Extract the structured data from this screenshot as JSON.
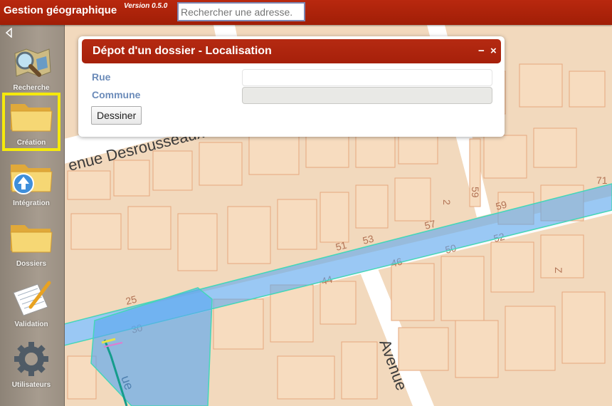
{
  "header": {
    "title": "Gestion géographique",
    "version": "Version 0.5.0",
    "search_placeholder": "Rechercher une adresse."
  },
  "sidebar": {
    "items": [
      {
        "label": "Recherche",
        "icon": "map-search-icon",
        "active": false
      },
      {
        "label": "Création",
        "icon": "folder-icon",
        "active": true
      },
      {
        "label": "Intégration",
        "icon": "folder-upload-icon",
        "active": false
      },
      {
        "label": "Dossiers",
        "icon": "folder-icon",
        "active": false
      },
      {
        "label": "Validation",
        "icon": "notepad-pencil-icon",
        "active": false
      },
      {
        "label": "Utilisateurs",
        "icon": "gear-icon",
        "active": false
      }
    ]
  },
  "dialog": {
    "title": "Dépot d'un dossier - Localisation",
    "minimize": "−",
    "close": "×",
    "fields": {
      "rue_label": "Rue",
      "rue_value": "",
      "commune_label": "Commune",
      "commune_value": ""
    },
    "draw_button": "Dessiner"
  },
  "map": {
    "street_labels": [
      "enue Desrousseaux",
      "Avenue",
      "ue"
    ],
    "house_numbers": [
      "51",
      "53",
      "57",
      "59",
      "59",
      "50",
      "52",
      "44",
      "46",
      "25",
      "30",
      "71",
      "2",
      "Z"
    ]
  },
  "colors": {
    "header": "#a82209",
    "block_fill": "#f7dcbf",
    "block_stroke": "#e6a77e",
    "number_text": "#b27355",
    "overlay_blue": "#5aa7f0",
    "active_outline": "#f5e90c"
  }
}
